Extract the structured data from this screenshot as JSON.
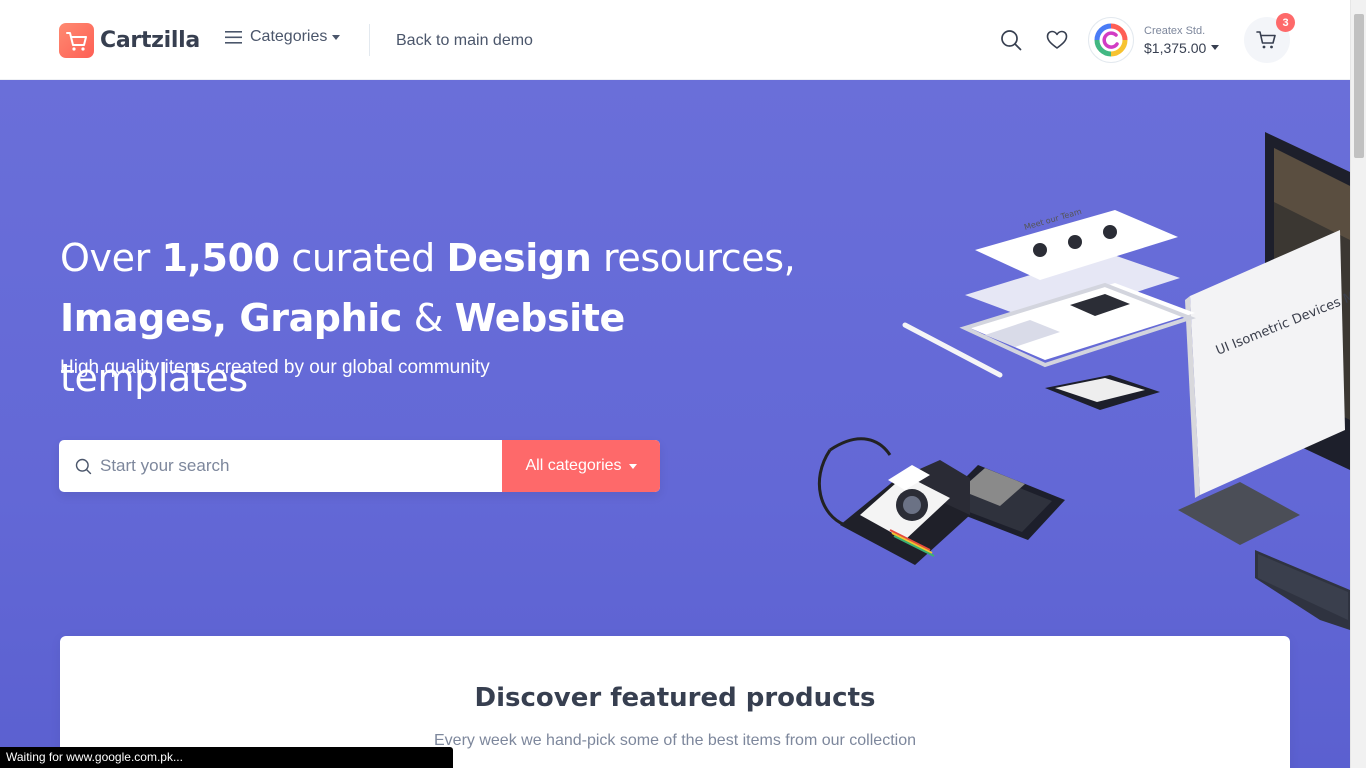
{
  "header": {
    "logo_text": "Cartzilla",
    "categories_label": "Categories",
    "back_label": "Back to main demo",
    "account": {
      "name": "Createx Std.",
      "balance": "$1,375.00"
    },
    "cart_count": "3"
  },
  "hero": {
    "title_parts": {
      "p1": "Over ",
      "p2": "1,500",
      "p3": " curated ",
      "p4": "Design",
      "p5": " resources,",
      "p6": "Images, Graphic",
      "p7": " & ",
      "p8": "Website",
      "p9": " templates"
    },
    "subtitle": "High quality items created by our global community",
    "search": {
      "placeholder": "Start your search",
      "button_label": "All categories"
    },
    "art": {
      "card_title": "UI Isometric Devices Mockup Pack",
      "team_title": "Meet our Team"
    }
  },
  "featured": {
    "title": "Discover featured products",
    "subtitle": "Every week we hand-pick some of the best items from our collection"
  },
  "status_bar": "Waiting for www.google.com.pk...",
  "colors": {
    "accent": "#fe696a",
    "hero_bg": "#6368d6",
    "text_dark": "#373f50",
    "text_muted": "#7d879c"
  },
  "icons": [
    "cart-logo-icon",
    "menu-icon",
    "search-icon",
    "heart-icon",
    "cart-icon"
  ]
}
